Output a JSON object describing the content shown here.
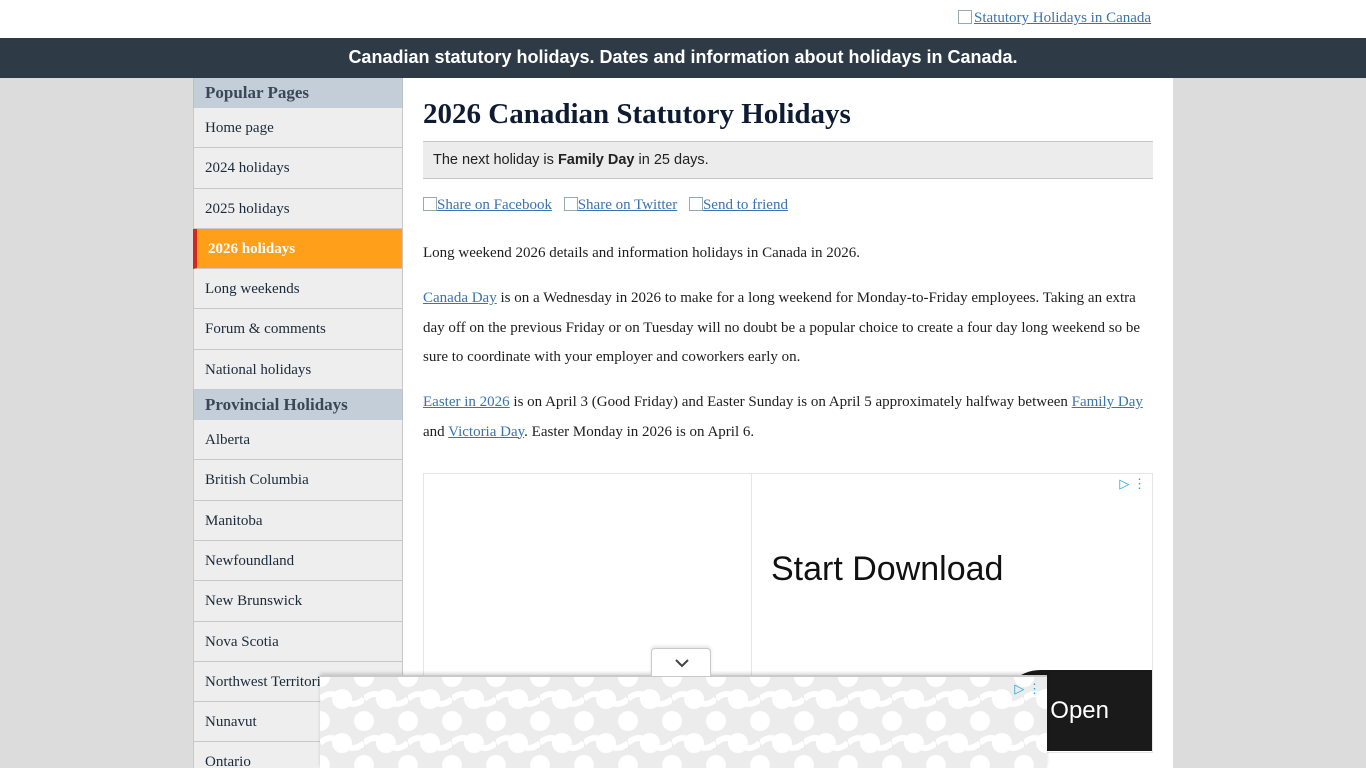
{
  "header": {
    "logo_alt": "Statutory Holidays in Canada",
    "banner": "Canadian statutory holidays. Dates and information about holidays in Canada."
  },
  "sidebar": {
    "popular_title": "Popular Pages",
    "popular_items": [
      {
        "label": "Home page",
        "active": false
      },
      {
        "label": "2024 holidays",
        "active": false
      },
      {
        "label": "2025 holidays",
        "active": false
      },
      {
        "label": "2026 holidays",
        "active": true
      },
      {
        "label": "Long weekends",
        "active": false
      },
      {
        "label": "Forum & comments",
        "active": false
      },
      {
        "label": "National holidays",
        "active": false
      }
    ],
    "provincial_title": "Provincial Holidays",
    "provincial_items": [
      {
        "label": "Alberta"
      },
      {
        "label": "British Columbia"
      },
      {
        "label": "Manitoba"
      },
      {
        "label": "Newfoundland"
      },
      {
        "label": "New Brunswick"
      },
      {
        "label": "Nova Scotia"
      },
      {
        "label": "Northwest Territories"
      },
      {
        "label": "Nunavut"
      },
      {
        "label": "Ontario"
      }
    ]
  },
  "main": {
    "title": "2026 Canadian Statutory Holidays",
    "next_holiday": {
      "prefix": "The next holiday is",
      "name": "Family Day",
      "suffix": "in 25 days."
    },
    "share": {
      "facebook": "Share on Facebook",
      "twitter": "Share on Twitter",
      "friend": "Send to friend"
    },
    "intro": "Long weekend 2026 details and information holidays in Canada in 2026.",
    "canada_day": {
      "link": "Canada Day",
      "text": " is on a Wednesday in 2026 to make for a long weekend for Monday-to-Friday employees. Taking an extra day off on the previous Friday or on Tuesday will no doubt be a popular choice to create a four day long weekend so be sure to coordinate with your employer and coworkers early on."
    },
    "easter": {
      "link": "Easter in 2026",
      "text1": " is on April 3 (Good Friday) and Easter Sunday is on April 5 approximately halfway between ",
      "link2": "Family Day",
      "text2": " and ",
      "link3": "Victoria Day",
      "text3": ". Easter Monday in 2026 is on April 6."
    }
  },
  "ad": {
    "title": "Start Download",
    "button": "Open",
    "icons": [
      "adchoices-icon",
      "more-options-icon"
    ]
  },
  "colors": {
    "banner_bg": "#2e3b47",
    "active_item": "#ff9f1a",
    "active_marker": "#d7261c",
    "link": "#3a73b0"
  }
}
